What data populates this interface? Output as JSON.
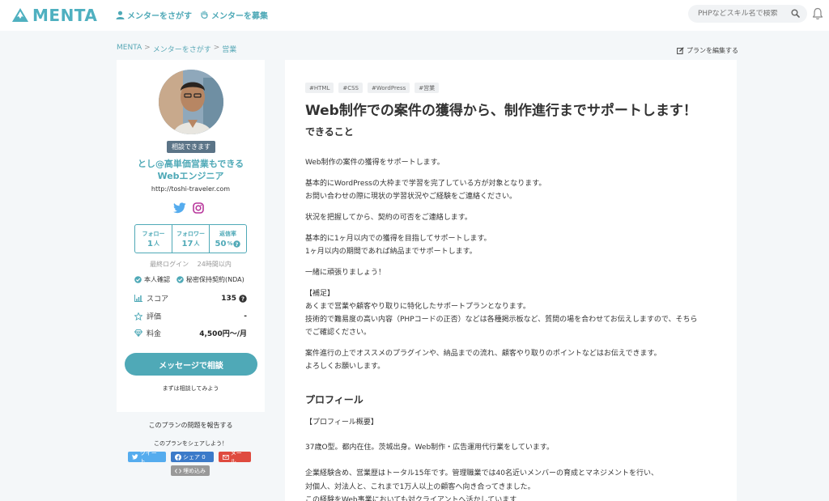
{
  "header": {
    "logo_text": "MENTA",
    "nav_find": "メンターをさがす",
    "nav_recruit": "メンターを募集",
    "search_placeholder": "PHPなどスキル名で検索"
  },
  "breadcrumb": [
    "MENTA",
    "メンターをさがす",
    "営業"
  ],
  "edit_plan": "プランを編集する",
  "mentor": {
    "badge": "相談できます",
    "name": "とし@高単価営業もできるWebエンジニア",
    "url": "http://toshi-traveler.com",
    "stats": [
      {
        "label": "フォロー",
        "value": "1",
        "unit": "人"
      },
      {
        "label": "フォロワー",
        "value": "17",
        "unit": "人"
      },
      {
        "label": "返信率",
        "value": "50",
        "unit": "%"
      }
    ],
    "last_login_label": "最終ログイン",
    "last_login_value": "24時間以内",
    "verif_identity": "本人確認",
    "verif_nda": "秘密保持契約(NDA)",
    "score_label": "スコア",
    "score_value": "135",
    "rating_label": "評価",
    "rating_value": "-",
    "price_label": "料金",
    "price_value": "4,500円〜/月",
    "cta": "メッセージで相談",
    "cta_sub": "まずは相談してみよう"
  },
  "sidebar_footer": {
    "report": "このプランの問題を報告する",
    "share_title": "このプランをシェアしよう！",
    "tweet": "ツイート",
    "fb_share": "シェア 0",
    "mail": "メール",
    "embed": "埋め込み"
  },
  "plan": {
    "tags": [
      "#HTML",
      "#CSS",
      "#WordPress",
      "#営業"
    ],
    "title": "Web制作での案件の獲得から、制作進行までサポートします！",
    "section_can": "できること",
    "p1": "Web制作の案件の獲得をサポートします。",
    "p2a": "基本的にWordPressの大枠まで学習を完了している方が対象となります。",
    "p2b": "お問い合わせの際に現状の学習状況やご経験をご連絡ください。",
    "p3": "状況を把握してから、契約の可否をご連絡します。",
    "p4a": "基本的に1ヶ月以内での獲得を目指してサポートします。",
    "p4b": "1ヶ月以内の期間であれば納品までサポートします。",
    "p5": "一緒に頑張りましょう！",
    "p6a": "【補足】",
    "p6b": "あくまで営業や顧客やり取りに特化したサポートプランとなります。",
    "p6c": "技術的で難易度の高い内容（PHPコードの正否）などは各種掲示板など、質問の場を合わせてお伝えしますので、そちら",
    "p6d": "でご確認ください。",
    "p7a": "案件進行の上でオススメのプラグインや、納品までの流れ、顧客やり取りのポイントなどはお伝えできます。",
    "p7b": "よろしくお願いします。",
    "section_profile": "プロフィール",
    "q1": "【プロフィール概要】",
    "q2": "37歳O型。都内在住。茨城出身。Web制作・広告運用代行業をしています。",
    "q3a": "企業経験含め、営業歴はトータル15年です。管理職業では40名近いメンバーの育成とマネジメントを行い、",
    "q3b": "対個人、対法人と、これまで1万人以上の顧客へ向き合ってきました。",
    "q3c": "この経験をWeb事業においても対クライアントへ活かしています"
  }
}
